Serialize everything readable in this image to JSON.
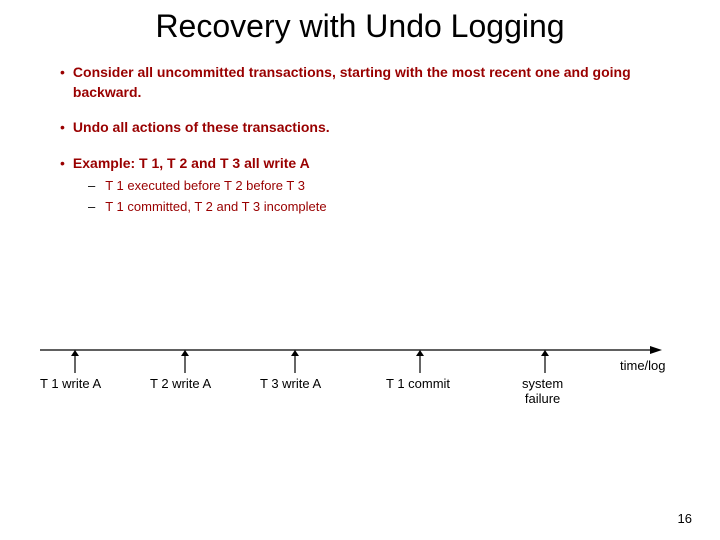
{
  "title": "Recovery with Undo Logging",
  "bullets": [
    "Consider all uncommitted transactions, starting with the most recent one and going backward.",
    "Undo all actions of these transactions.",
    "Example: T 1, T 2 and T 3 all write A"
  ],
  "subs": [
    "T 1 executed before T 2 before T 3",
    "T 1 committed, T 2 and T 3 incomplete"
  ],
  "timeline": {
    "events": [
      "T 1 write A",
      "T 2 write A",
      "T 3 write A",
      "T 1 commit",
      "system\nfailure"
    ],
    "axis_label": "time/log"
  },
  "page_number": "16"
}
